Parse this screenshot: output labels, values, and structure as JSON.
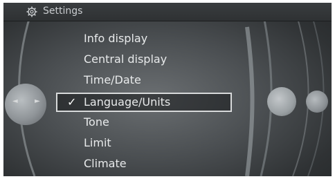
{
  "header": {
    "title": "Settings",
    "icon": "gear-icon"
  },
  "menu": {
    "items": [
      {
        "label": "Info display"
      },
      {
        "label": "Central display"
      },
      {
        "label": "Time/Date"
      },
      {
        "label": "Language/Units",
        "selected": true,
        "check": "✓"
      },
      {
        "label": "Tone"
      },
      {
        "label": "Limit"
      },
      {
        "label": "Climate"
      }
    ]
  },
  "controls": {
    "left_knob": {
      "icon": "left-right-nav-icon",
      "left_arrow": "◄",
      "right_arrow": "►"
    },
    "right_knobs": [
      "scroll-knob-icon",
      "scroll-knob-icon"
    ]
  }
}
